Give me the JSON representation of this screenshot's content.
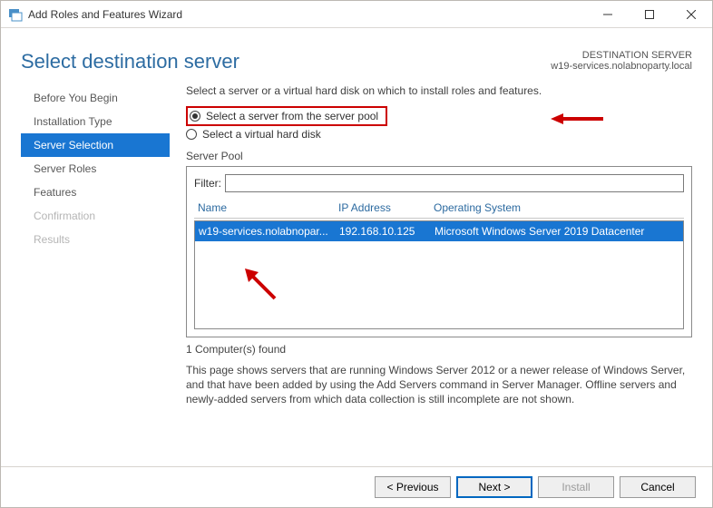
{
  "window": {
    "title": "Add Roles and Features Wizard"
  },
  "header": {
    "page_title": "Select destination server",
    "dest_label": "DESTINATION SERVER",
    "dest_name": "w19-services.nolabnoparty.local"
  },
  "nav": {
    "items": [
      {
        "label": "Before You Begin",
        "state": "normal"
      },
      {
        "label": "Installation Type",
        "state": "normal"
      },
      {
        "label": "Server Selection",
        "state": "active"
      },
      {
        "label": "Server Roles",
        "state": "normal"
      },
      {
        "label": "Features",
        "state": "normal"
      },
      {
        "label": "Confirmation",
        "state": "disabled"
      },
      {
        "label": "Results",
        "state": "disabled"
      }
    ]
  },
  "content": {
    "intro": "Select a server or a virtual hard disk on which to install roles and features.",
    "radio_pool": "Select a server from the server pool",
    "radio_vhd": "Select a virtual hard disk",
    "section_label": "Server Pool",
    "filter_label": "Filter:",
    "filter_value": "",
    "columns": {
      "name": "Name",
      "ip": "IP Address",
      "os": "Operating System"
    },
    "rows": [
      {
        "name": "w19-services.nolabnopar...",
        "ip": "192.168.10.125",
        "os": "Microsoft Windows Server 2019 Datacenter"
      }
    ],
    "found": "1 Computer(s) found",
    "description": "This page shows servers that are running Windows Server 2012 or a newer release of Windows Server, and that have been added by using the Add Servers command in Server Manager. Offline servers and newly-added servers from which data collection is still incomplete are not shown."
  },
  "buttons": {
    "previous": "< Previous",
    "next": "Next >",
    "install": "Install",
    "cancel": "Cancel"
  }
}
